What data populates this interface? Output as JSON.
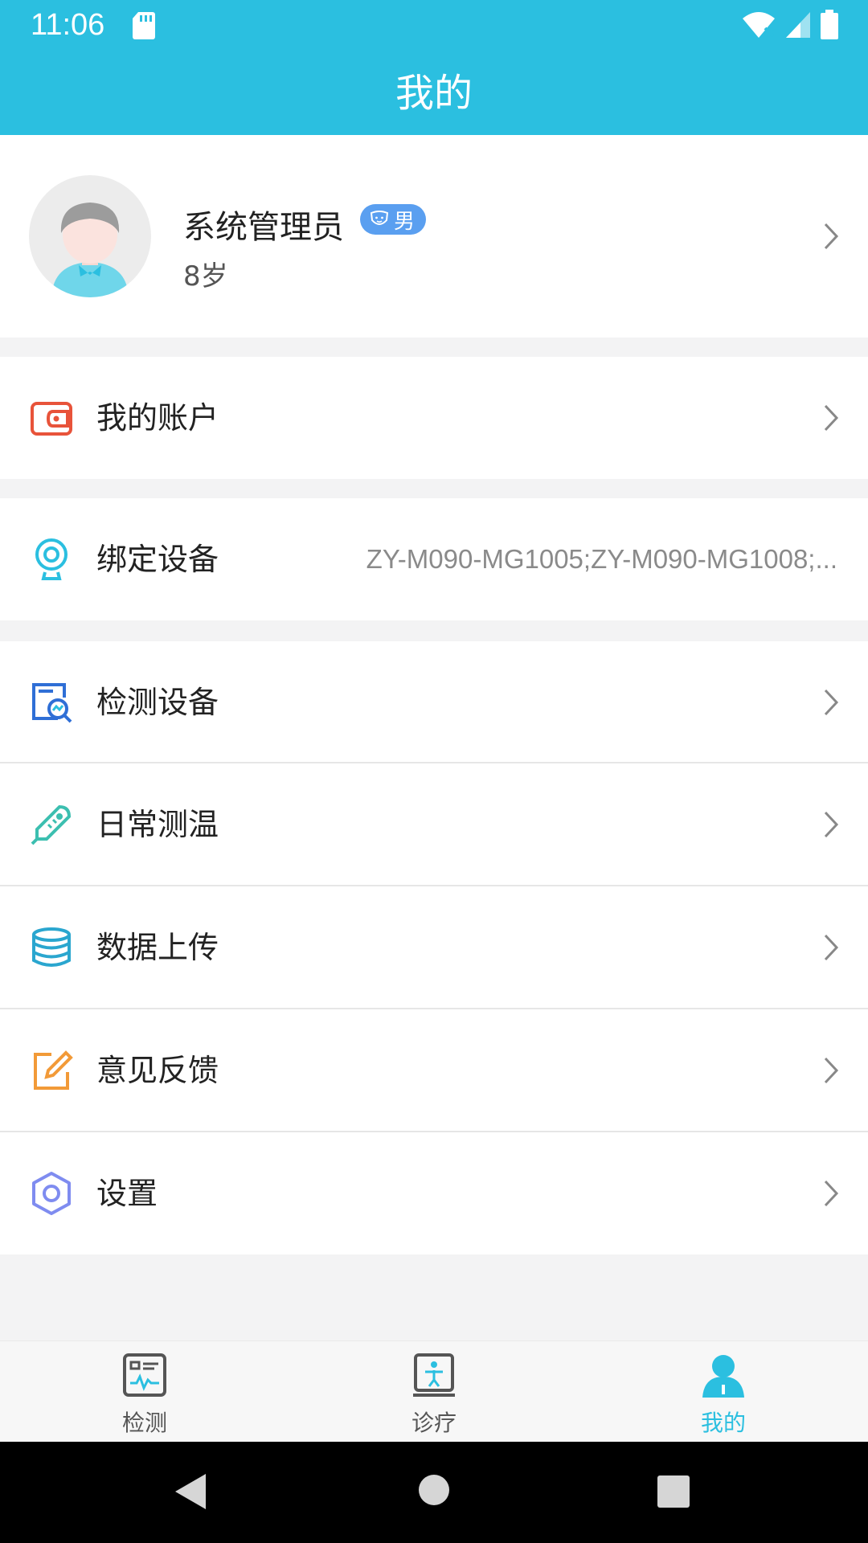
{
  "status_bar": {
    "time": "11:06"
  },
  "app_bar": {
    "title": "我的"
  },
  "profile": {
    "name": "系统管理员",
    "gender": "男",
    "age": "8岁"
  },
  "menu": {
    "account": {
      "label": "我的账户",
      "icon": "wallet-icon"
    },
    "bind_device": {
      "label": "绑定设备",
      "value": "ZY-M090-MG1005;ZY-M090-MG1008;...",
      "icon": "webcam-icon"
    },
    "detect_device": {
      "label": "检测设备",
      "icon": "device-check-icon"
    },
    "temperature": {
      "label": "日常测温",
      "icon": "thermometer-icon"
    },
    "upload": {
      "label": "数据上传",
      "icon": "database-icon"
    },
    "feedback": {
      "label": "意见反馈",
      "icon": "edit-icon"
    },
    "settings": {
      "label": "设置",
      "icon": "gear-icon"
    }
  },
  "tabs": [
    {
      "label": "检测",
      "icon": "monitor-icon",
      "active": false
    },
    {
      "label": "诊疗",
      "icon": "treatment-icon",
      "active": false
    },
    {
      "label": "我的",
      "icon": "user-icon",
      "active": true
    }
  ],
  "colors": {
    "accent": "#2bbfe0",
    "badge": "#5a9ff0",
    "wallet": "#e8533a",
    "device_check": "#2f6fd6",
    "thermometer": "#3cbfb0",
    "feedback": "#f29a38",
    "settings": "#7f8cf0"
  }
}
